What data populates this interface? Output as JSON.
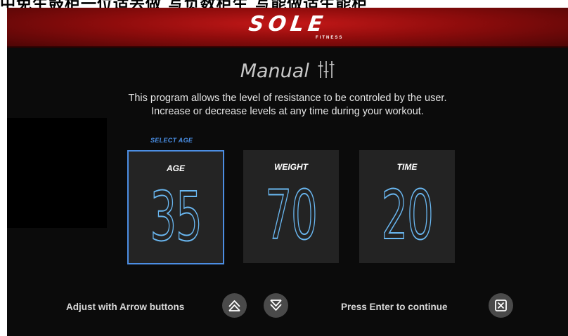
{
  "caption": "中免生鼓柜一位适丢做 写负数柜生 写能做适生能柜",
  "brand": {
    "name": "SOLE",
    "sub": "FITNESS"
  },
  "program": {
    "title": "Manual",
    "icon": "sliders-icon",
    "description_line1": "This program allows the level of resistance to be controled by the user.",
    "description_line2": "Increase or decrease levels at any time during your workout."
  },
  "selector": {
    "hint": "SELECT AGE",
    "fields": [
      {
        "label": "AGE",
        "value": "35",
        "selected": true
      },
      {
        "label": "WEIGHT",
        "value": "70",
        "selected": false
      },
      {
        "label": "TIME",
        "value": "20",
        "selected": false
      }
    ]
  },
  "footer": {
    "adjust_text": "Adjust with Arrow buttons",
    "up_icon": "arrow-up-icon",
    "down_icon": "arrow-down-icon",
    "enter_text": "Press Enter to continue",
    "enter_icon": "enter-x-icon"
  },
  "colors": {
    "accent": "#5fb3ef",
    "brand_red": "#a01010",
    "background": "#0b0b0b",
    "card": "#232323"
  }
}
